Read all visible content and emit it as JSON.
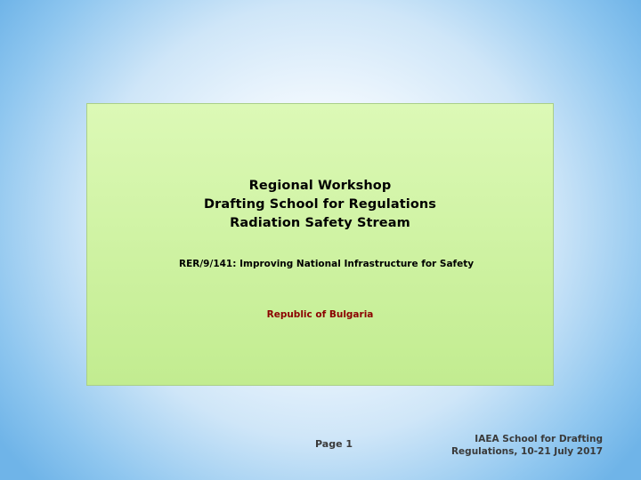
{
  "slide": {
    "title_lines": [
      "Regional Workshop",
      "Drafting School for Regulations",
      "Radiation Safety Stream"
    ],
    "project": "RER/9/141: Improving National Infrastructure for Safety",
    "country": "Republic of Bulgaria"
  },
  "footer": {
    "page_label": "Page 1",
    "event_line1": "IAEA School for Drafting",
    "event_line2": "Regulations, 10-21 July 2017"
  },
  "colors": {
    "box_fill": "#d0f3a4",
    "country_text": "#8b0000",
    "background_edge": "#6fb4e8"
  }
}
